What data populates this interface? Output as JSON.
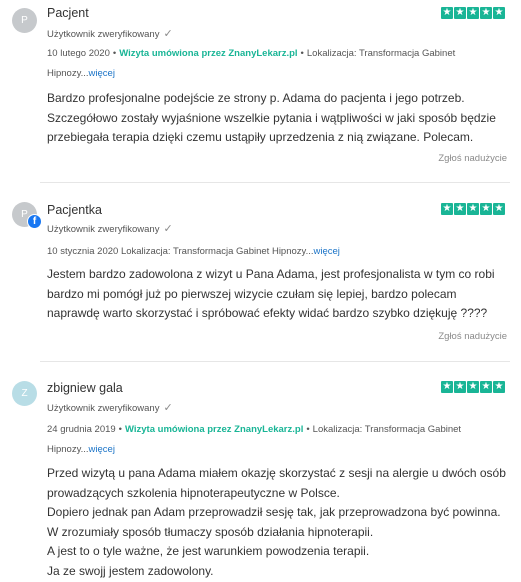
{
  "reviews": [
    {
      "avatar_letter": "P",
      "avatar_color": "#c6c9cc",
      "name": "Pacjent",
      "verified": "Użytkownik zweryfikowany",
      "date": "10 lutego 2020",
      "visit": "Wizyta umówiona przez ZnanyLekarz.pl",
      "location": "Lokalizacja: Transformacja Gabinet Hipnozy...",
      "more": "więcej",
      "stars": 5,
      "text": [
        "Bardzo profesjonalne podejście ze strony p. Adama do pacjenta i jego potrzeb.",
        "Szczegółowo zostały wyjaśnione wszelkie pytania i wątpliwości w jaki sposób będzie",
        "przebiegała terapia dzięki czemu ustąpiły uprzedzenia z nią związane. Polecam."
      ],
      "report": "Zgłoś nadużycie"
    },
    {
      "avatar_letter": "P",
      "avatar_color": "#c6c9cc",
      "name": "Pacjentka",
      "verified": "Użytkownik zweryfikowany",
      "date": "10 stycznia 2020",
      "location": "Lokalizacja: Transformacja Gabinet Hipnozy...",
      "more": "więcej",
      "stars": 5,
      "text": [
        "Jestem bardzo zadowolona z wizyt u Pana Adama, jest profesjonalista w tym co robi",
        "bardzo mi pomógł już po pierwszej wizycie czułam się lepiej, bardzo polecam",
        "naprawdę warto skorzystać i spróbować efekty widać bardzo szybko dziękuję ????"
      ],
      "report": "Zgłoś nadużycie"
    },
    {
      "avatar_letter": "Z",
      "avatar_color": "#b8dde6",
      "name": "zbigniew gala",
      "verified": "Użytkownik zweryfikowany",
      "date": "24 grudnia 2019",
      "visit": "Wizyta umówiona przez ZnanyLekarz.pl",
      "location": "Lokalizacja: Transformacja Gabinet Hipnozy...",
      "more": "więcej",
      "stars": 5,
      "text": [
        "Przed wizytą u pana Adama miałem okazję skorzystać z sesji na alergie u dwóch osób",
        "prowadzących szkolenia hipnoterapeutyczne w Polsce.",
        "Dopiero jednak pan Adam przeprowadził sesję tak, jak przeprowadzona być powinna.",
        "W zrozumiały sposób tłumaczy sposób działania hipnoterapii.",
        "A jest to o tyle ważne, że jest warunkiem powodzenia terapii.",
        "Ja ze swojj jestem zadowolony."
      ]
    }
  ],
  "star_glyph": "★",
  "check_glyph": "✓",
  "fb_glyph": "f",
  "separator": "•"
}
